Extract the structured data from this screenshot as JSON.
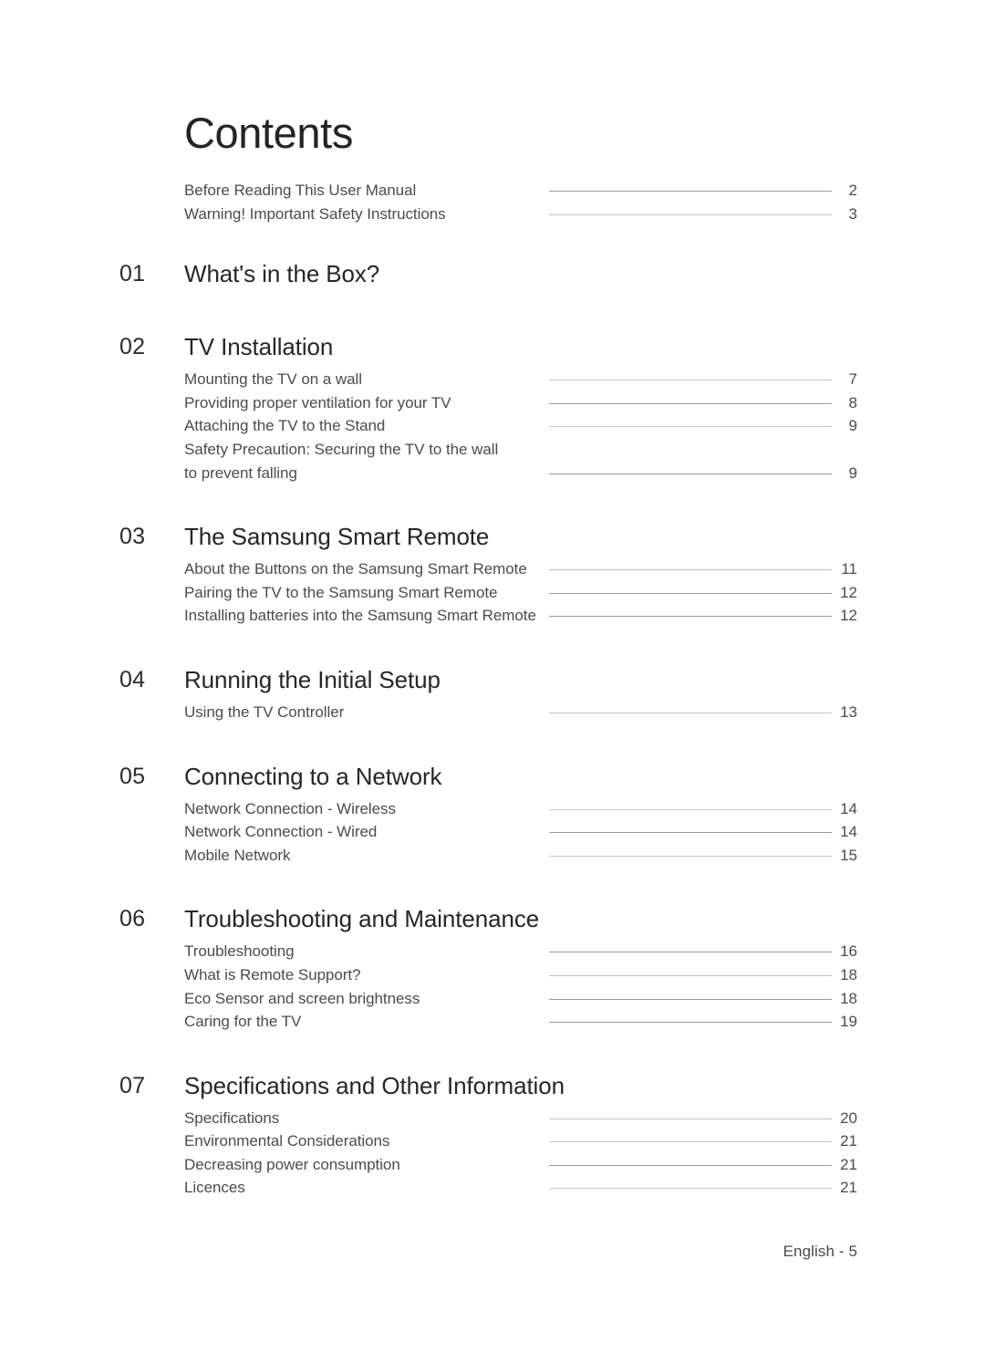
{
  "page": {
    "title": "Contents",
    "footer": "English - 5",
    "text_color": "#4b4b4b",
    "heading_color": "#242424",
    "leader_color": "#9b9b9b"
  },
  "preface": {
    "entries": [
      {
        "label": "Before Reading This User Manual",
        "page": "2"
      },
      {
        "label": "Warning! Important Safety Instructions",
        "page": "3"
      }
    ]
  },
  "sections": [
    {
      "number": "01",
      "title": "What's in the Box?",
      "entries": []
    },
    {
      "number": "02",
      "title": "TV Installation",
      "entries": [
        {
          "label": "Mounting the TV on a wall",
          "page": "7"
        },
        {
          "label": "Providing proper ventilation for your TV",
          "page": "8"
        },
        {
          "label": "Attaching the TV to the Stand",
          "page": "9"
        },
        {
          "label": "Safety Precaution: Securing the TV to the wall",
          "page": ""
        },
        {
          "label": "to prevent falling",
          "page": "9"
        }
      ]
    },
    {
      "number": "03",
      "title": "The Samsung Smart Remote",
      "entries": [
        {
          "label": "About the Buttons on the Samsung Smart Remote",
          "page": "11"
        },
        {
          "label": "Pairing the TV to the Samsung Smart Remote",
          "page": "12"
        },
        {
          "label": "Installing batteries into the Samsung Smart Remote",
          "page": "12"
        }
      ]
    },
    {
      "number": "04",
      "title": "Running the Initial Setup",
      "entries": [
        {
          "label": "Using the TV Controller",
          "page": "13"
        }
      ]
    },
    {
      "number": "05",
      "title": "Connecting to a Network",
      "entries": [
        {
          "label": "Network Connection - Wireless",
          "page": "14"
        },
        {
          "label": "Network Connection - Wired",
          "page": "14"
        },
        {
          "label": "Mobile Network",
          "page": "15"
        }
      ]
    },
    {
      "number": "06",
      "title": "Troubleshooting and Maintenance",
      "entries": [
        {
          "label": "Troubleshooting",
          "page": "16"
        },
        {
          "label": "What is Remote Support?",
          "page": "18"
        },
        {
          "label": "Eco Sensor and screen brightness",
          "page": "18"
        },
        {
          "label": "Caring for the TV",
          "page": "19"
        }
      ]
    },
    {
      "number": "07",
      "title": "Specifications and Other Information",
      "entries": [
        {
          "label": "Specifications",
          "page": "20"
        },
        {
          "label": "Environmental Considerations",
          "page": "21"
        },
        {
          "label": "Decreasing power consumption",
          "page": "21"
        },
        {
          "label": "Licences",
          "page": "21"
        }
      ]
    }
  ]
}
